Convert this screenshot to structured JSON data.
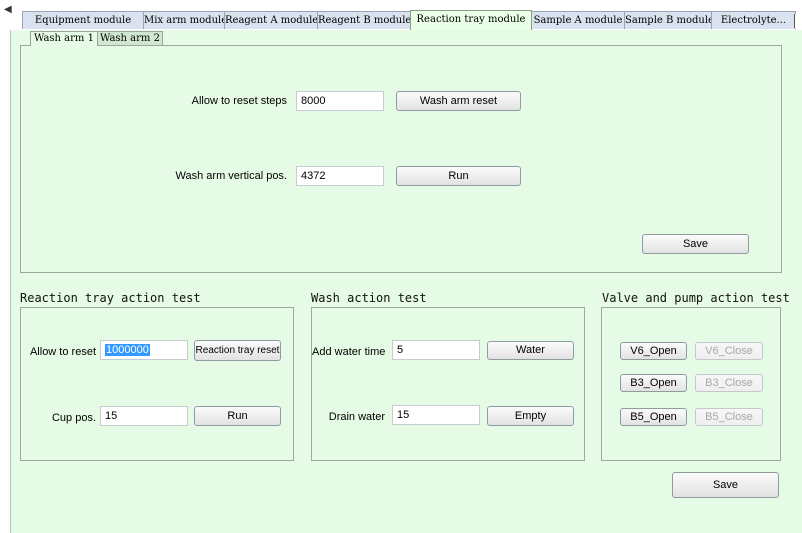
{
  "tabs": [
    "Equipment module",
    "Mix arm module",
    "Reagent A module",
    "Reagent B module",
    "Reaction tray module",
    "Sample A module",
    "Sample B module",
    "Electrolyte..."
  ],
  "subtabs": [
    "Wash arm 1",
    "Wash arm 2"
  ],
  "wash_arm": {
    "reset_steps_label": "Allow to reset steps",
    "reset_steps_value": "8000",
    "reset_button": "Wash arm reset",
    "vertical_label": "Wash arm vertical pos.",
    "vertical_value": "4372",
    "run_button": "Run",
    "save_button": "Save"
  },
  "reaction_tray": {
    "title": "Reaction tray action test",
    "allow_reset_label": "Allow to reset",
    "allow_reset_value": "1000000",
    "reset_button": "Reaction tray reset",
    "cup_label": "Cup pos.",
    "cup_value": "15",
    "run_button": "Run"
  },
  "wash_action": {
    "title": "Wash action test",
    "add_water_label": "Add water time",
    "add_water_value": "5",
    "water_button": "Water",
    "drain_label": "Drain water",
    "drain_value": "15",
    "empty_button": "Empty"
  },
  "valve_pump": {
    "title": "Valve and pump action test",
    "buttons": [
      {
        "open": "V6_Open",
        "close": "V6_Close"
      },
      {
        "open": "B3_Open",
        "close": "B3_Close"
      },
      {
        "open": "B5_Open",
        "close": "B5_Close"
      }
    ]
  },
  "footer": {
    "save_button": "Save"
  }
}
